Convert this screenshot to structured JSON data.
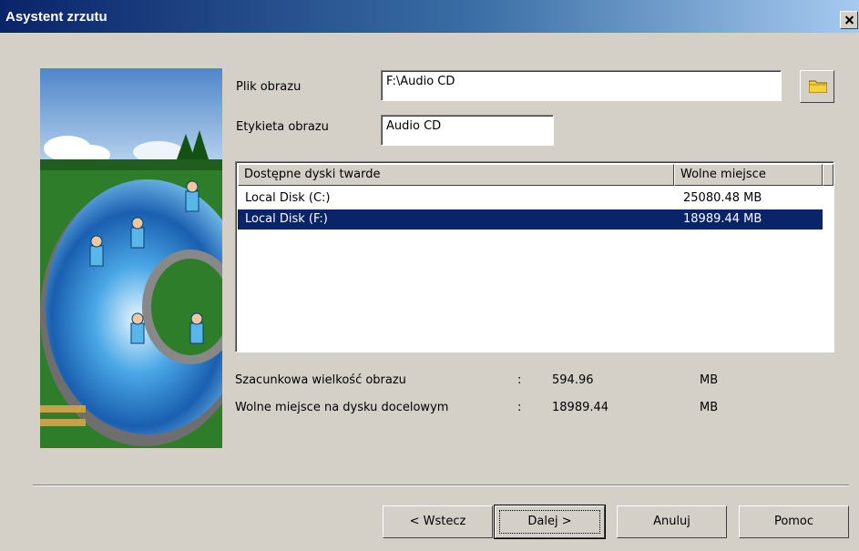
{
  "window": {
    "title": "Asystent zrzutu"
  },
  "image_file": {
    "label": "Plik obrazu",
    "value": "F:\\Audio CD"
  },
  "image_label": {
    "label": "Etykieta obrazu",
    "value": "Audio CD"
  },
  "disks": {
    "columns": [
      "Dostępne dyski twarde",
      "Wolne miejsce"
    ],
    "rows": [
      {
        "name": "Local Disk (C:)",
        "free": "25080.48 MB",
        "selected": false
      },
      {
        "name": "Local Disk (F:)",
        "free": "18989.44 MB",
        "selected": true
      }
    ]
  },
  "info": {
    "estimated_size": {
      "label": "Szacunkowa wielkość obrazu",
      "sep": ":",
      "value": "594.96",
      "unit": "MB"
    },
    "free_space": {
      "label": "Wolne miejsce na dysku docelowym",
      "sep": ":",
      "value": "18989.44",
      "unit": "MB"
    }
  },
  "buttons": {
    "back": "< Wstecz",
    "next": "Dalej >",
    "cancel": "Anuluj",
    "help": "Pomoc"
  },
  "icons": {
    "close": "close-icon",
    "browse": "folder-icon"
  }
}
